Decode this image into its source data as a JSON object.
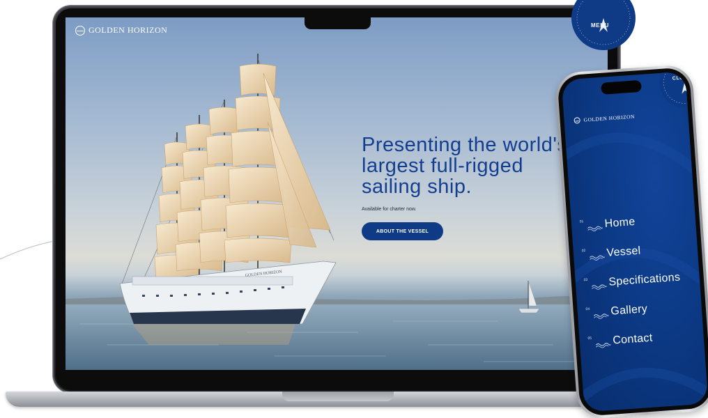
{
  "desktop": {
    "brand": "GOLDEN HORIZON",
    "menu_label": "MENU",
    "hero": {
      "title": "Presenting the world's largest full-rigged sailing ship.",
      "subtitle": "Available for charter now.",
      "cta_label": "ABOUT THE VESSEL"
    },
    "ship_name": "GOLDEN HORIZON"
  },
  "mobile": {
    "brand": "GOLDEN HORIZON",
    "close_label": "CLOSE",
    "nav": [
      {
        "num": "01",
        "label": "Home"
      },
      {
        "num": "02",
        "label": "Vessel"
      },
      {
        "num": "03",
        "label": "Specifications"
      },
      {
        "num": "04",
        "label": "Gallery"
      },
      {
        "num": "05",
        "label": "Contact"
      }
    ]
  },
  "colors": {
    "brand_blue": "#0f3a86",
    "hero_title": "#133e8f",
    "menu_bg": "#0c3a86"
  },
  "icons": [
    "logo-mark-icon",
    "compass-dial-icon",
    "wave-icon"
  ]
}
